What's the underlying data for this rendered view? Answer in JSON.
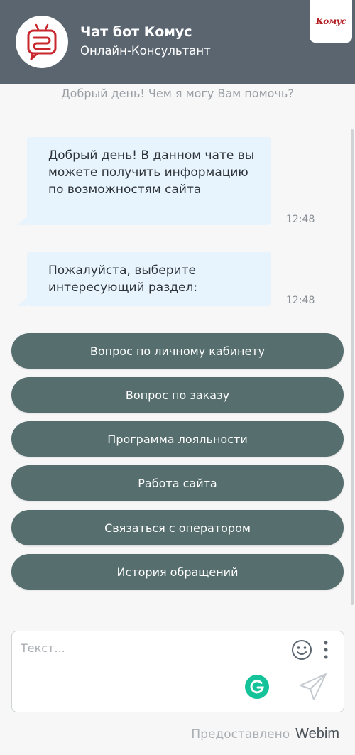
{
  "header": {
    "bot_name": "Чат бот Комус",
    "bot_subtitle": "Онлайн-Консультант",
    "brand_logo": "Комус",
    "colors": {
      "header_bg": "#5a6570",
      "brand_red": "#b41e23"
    }
  },
  "greeting": "Добрый день! Чем я могу Вам помочь?",
  "messages": [
    {
      "text": "Добрый день! В данном чате вы можете получить информацию по возможностям сайта",
      "time": "12:48"
    },
    {
      "text": "Пожалуйста, выберите интересующий раздел:",
      "time": "12:48"
    }
  ],
  "quick_replies": [
    "Вопрос по личному кабинету",
    "Вопрос по заказу",
    "Программа лояльности",
    "Работа сайта",
    "Связаться с оператором",
    "История обращений"
  ],
  "composer": {
    "placeholder": "Текст...",
    "icons": [
      "smile-icon",
      "more-vertical-icon",
      "grammarly-icon",
      "send-icon"
    ]
  },
  "footer": {
    "powered_by": "Предоставлено",
    "provider": "Webim"
  },
  "colors": {
    "button_bg": "#566e6e",
    "bubble_bg": "#e8f4fd"
  }
}
